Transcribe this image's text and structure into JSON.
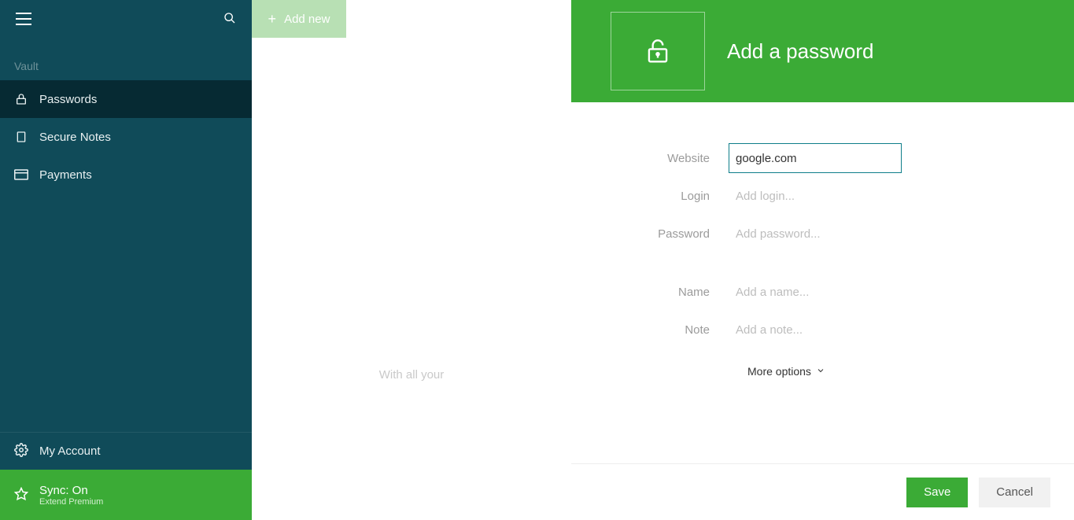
{
  "sidebar": {
    "section_label": "Vault",
    "items": [
      {
        "label": "Passwords",
        "icon": "lock-icon"
      },
      {
        "label": "Secure Notes",
        "icon": "note-icon"
      },
      {
        "label": "Payments",
        "icon": "card-icon"
      }
    ],
    "account_label": "My Account",
    "sync_title": "Sync: On",
    "sync_sub": "Extend Premium"
  },
  "middle": {
    "add_new_label": "Add new",
    "empty_hint": "With all your"
  },
  "panel": {
    "title": "Add a password",
    "fields": {
      "website": {
        "label": "Website",
        "value": "google.com",
        "placeholder": ""
      },
      "login": {
        "label": "Login",
        "value": "",
        "placeholder": "Add login..."
      },
      "password": {
        "label": "Password",
        "value": "",
        "placeholder": "Add password..."
      },
      "name": {
        "label": "Name",
        "value": "",
        "placeholder": "Add a name..."
      },
      "note": {
        "label": "Note",
        "value": "",
        "placeholder": "Add a note..."
      }
    },
    "more_options_label": "More options",
    "save_label": "Save",
    "cancel_label": "Cancel"
  }
}
